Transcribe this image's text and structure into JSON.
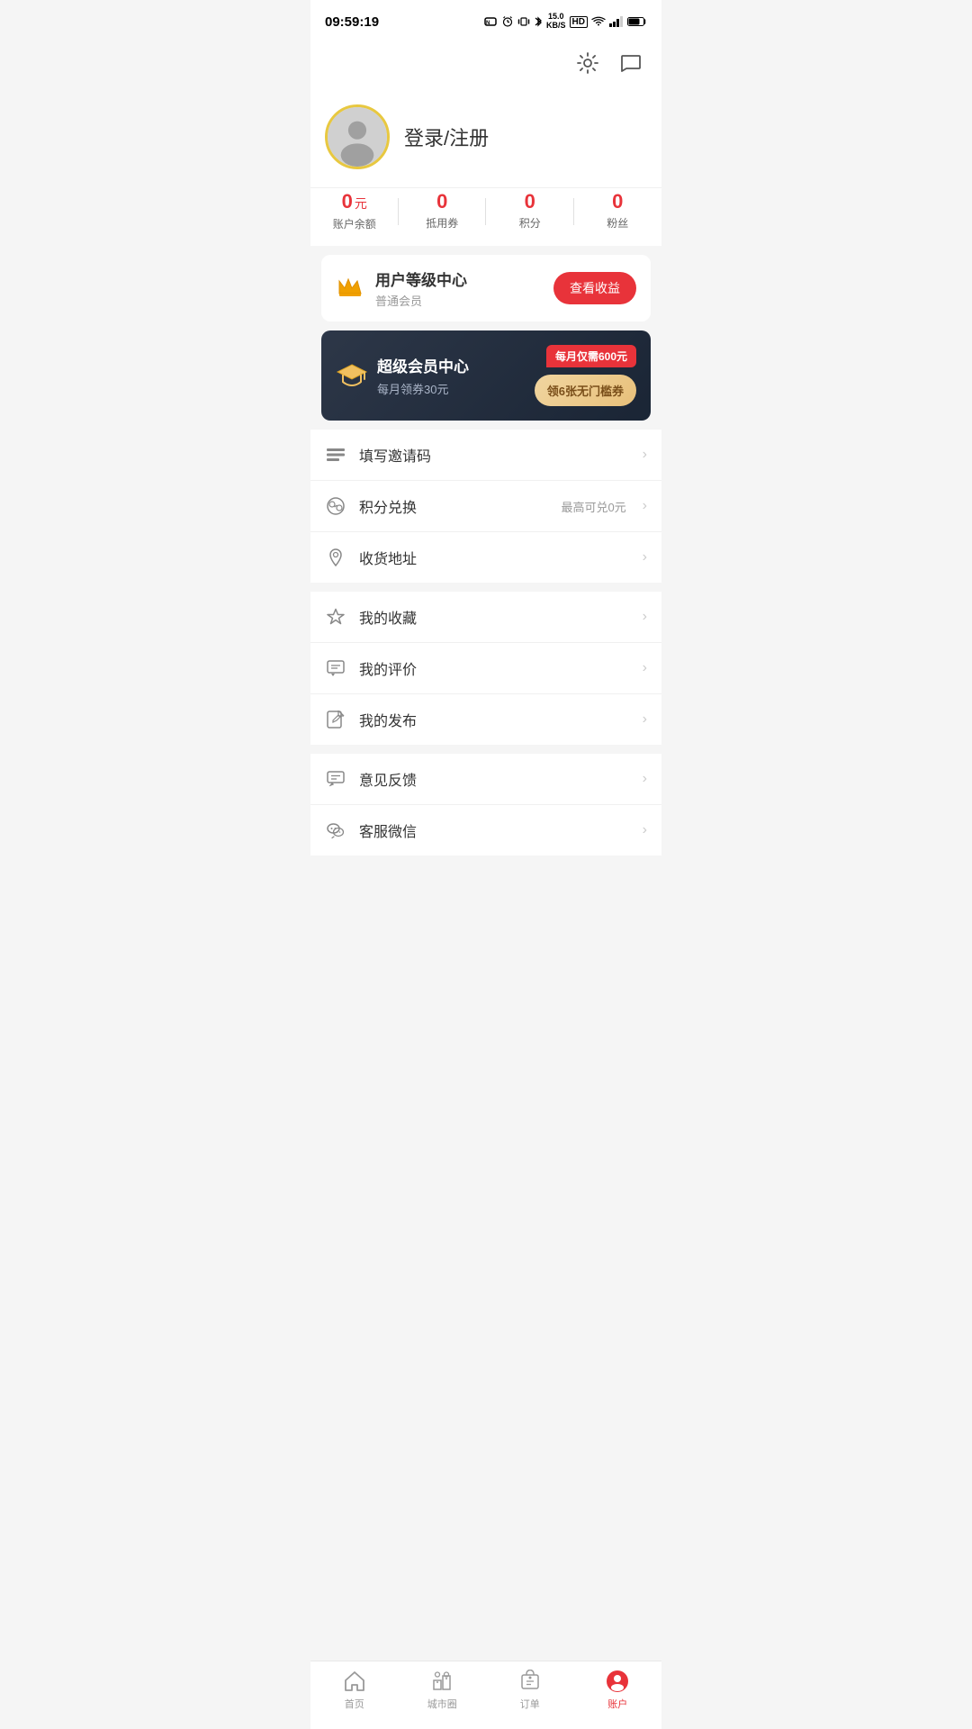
{
  "statusBar": {
    "time": "09:59:19",
    "icons": "NFC alarm vibrate bluetooth speed HD wifi signal battery"
  },
  "header": {
    "settingsIcon": "gear",
    "messageIcon": "chat-bubble"
  },
  "profile": {
    "loginText": "登录/注册",
    "avatarAlt": "user avatar"
  },
  "stats": [
    {
      "value": "0",
      "unit": "元",
      "label": "账户余额"
    },
    {
      "value": "0",
      "unit": "",
      "label": "抵用券"
    },
    {
      "value": "0",
      "unit": "",
      "label": "积分"
    },
    {
      "value": "0",
      "unit": "",
      "label": "粉丝"
    }
  ],
  "vipLevelCard": {
    "icon": "crown",
    "title": "用户等级中心",
    "subtitle": "普通会员",
    "buttonLabel": "查看收益"
  },
  "superVipCard": {
    "icon": "graduation-cap",
    "title": "超级会员中心",
    "subtitle": "每月领券30元",
    "priceTag": "每月仅需600元",
    "couponButton": "领6张无门槛券"
  },
  "menuGroups": [
    {
      "items": [
        {
          "icon": "lines",
          "label": "填写邀请码",
          "meta": "",
          "arrow": true
        },
        {
          "icon": "coin-exchange",
          "label": "积分兑换",
          "meta": "最高可兑0元",
          "arrow": true
        },
        {
          "icon": "location-pin",
          "label": "收货地址",
          "meta": "",
          "arrow": true
        }
      ]
    },
    {
      "items": [
        {
          "icon": "star",
          "label": "我的收藏",
          "meta": "",
          "arrow": true
        },
        {
          "icon": "comment",
          "label": "我的评价",
          "meta": "",
          "arrow": true
        },
        {
          "icon": "edit",
          "label": "我的发布",
          "meta": "",
          "arrow": true
        }
      ]
    },
    {
      "items": [
        {
          "icon": "feedback",
          "label": "意见反馈",
          "meta": "",
          "arrow": true
        },
        {
          "icon": "wechat",
          "label": "客服微信",
          "meta": "",
          "arrow": true
        }
      ]
    }
  ],
  "tabBar": {
    "items": [
      {
        "icon": "home",
        "label": "首页",
        "active": false
      },
      {
        "icon": "city-circle",
        "label": "城市圈",
        "active": false
      },
      {
        "icon": "order",
        "label": "订单",
        "active": false
      },
      {
        "icon": "account",
        "label": "账户",
        "active": true
      }
    ]
  }
}
